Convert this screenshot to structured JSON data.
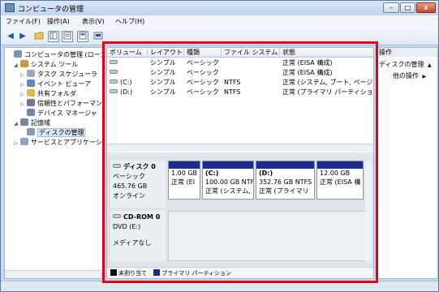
{
  "window": {
    "title": "コンピュータの管理",
    "min": "–",
    "max": "□",
    "close": "x"
  },
  "menu": [
    "ファイル(F)",
    "操作(A)",
    "表示(V)",
    "ヘルプ(H)"
  ],
  "toolbar": {
    "back": "◀",
    "forward": "▶"
  },
  "tree": [
    {
      "label": "コンピュータの管理 (ローカル)",
      "indent": 0,
      "twisty": "",
      "color": "#7d95b7"
    },
    {
      "label": "システム ツール",
      "indent": 1,
      "twisty": "◢",
      "color": "#c79a3a"
    },
    {
      "label": "タスク スケジューラ",
      "indent": 2,
      "twisty": "▷",
      "color": "#a0a9b5"
    },
    {
      "label": "イベント ビューア",
      "indent": 2,
      "twisty": "▷",
      "color": "#5c88c4"
    },
    {
      "label": "共有フォルダ",
      "indent": 2,
      "twisty": "▷",
      "color": "#e2b64a"
    },
    {
      "label": "信頼性とパフォーマンス",
      "indent": 2,
      "twisty": "▷",
      "color": "#6d7a8c"
    },
    {
      "label": "デバイス マネージャ",
      "indent": 2,
      "twisty": "",
      "color": "#7089a6"
    },
    {
      "label": "記憶域",
      "indent": 1,
      "twisty": "◢",
      "color": "#7b8797"
    },
    {
      "label": "ディスクの管理",
      "indent": 2,
      "twisty": "",
      "color": "#8d99aa",
      "selected": true
    },
    {
      "label": "サービスとアプリケーション",
      "indent": 1,
      "twisty": "▷",
      "color": "#8aa3c4"
    }
  ],
  "volumes": {
    "columns": [
      "ボリューム",
      "レイアウト",
      "種類",
      "ファイル システム",
      "状態"
    ],
    "rows": [
      [
        "",
        "シンプル",
        "ベーシック",
        "",
        "正常 (EISA 構成)"
      ],
      [
        "",
        "シンプル",
        "ベーシック",
        "",
        "正常 (EISA 構成)"
      ],
      [
        "(C:)",
        "シンプル",
        "ベーシック",
        "NTFS",
        "正常 (システム, ブート, ページ"
      ],
      [
        "(D:)",
        "シンプル",
        "ベーシック",
        "NTFS",
        "正常 (プライマリ パーティショ"
      ]
    ]
  },
  "disk0": {
    "name": "ディスク 0",
    "type": "ベーシック",
    "size": "465.76 GB",
    "status": "オンライン",
    "partitions": [
      {
        "title": "",
        "line1": "1.00 GB",
        "line2": "正常 (EI"
      },
      {
        "title": "(C:)",
        "line1": "100.00 GB NTFS",
        "line2": "正常 (システム,"
      },
      {
        "title": "(D:)",
        "line1": "352.76 GB NTFS",
        "line2": "正常 (プライマリ"
      },
      {
        "title": "",
        "line1": "12.00 GB",
        "line2": "正常 (EISA 構"
      }
    ]
  },
  "cdrom0": {
    "name": "CD-ROM 0",
    "drive": "DVD (E:)",
    "media": "メディアなし"
  },
  "legend": [
    {
      "label": "未割り当て",
      "color": "#111111"
    },
    {
      "label": "プライマリ パーティション",
      "color": "#1c2c8c"
    }
  ],
  "actions": {
    "header": "操作",
    "items": [
      "ディスクの管理",
      "他の操作"
    ],
    "arrows": [
      "▲",
      "▶"
    ]
  },
  "colors": {
    "highlight": "#e60012",
    "partition_bar": "#1c2c8c"
  }
}
